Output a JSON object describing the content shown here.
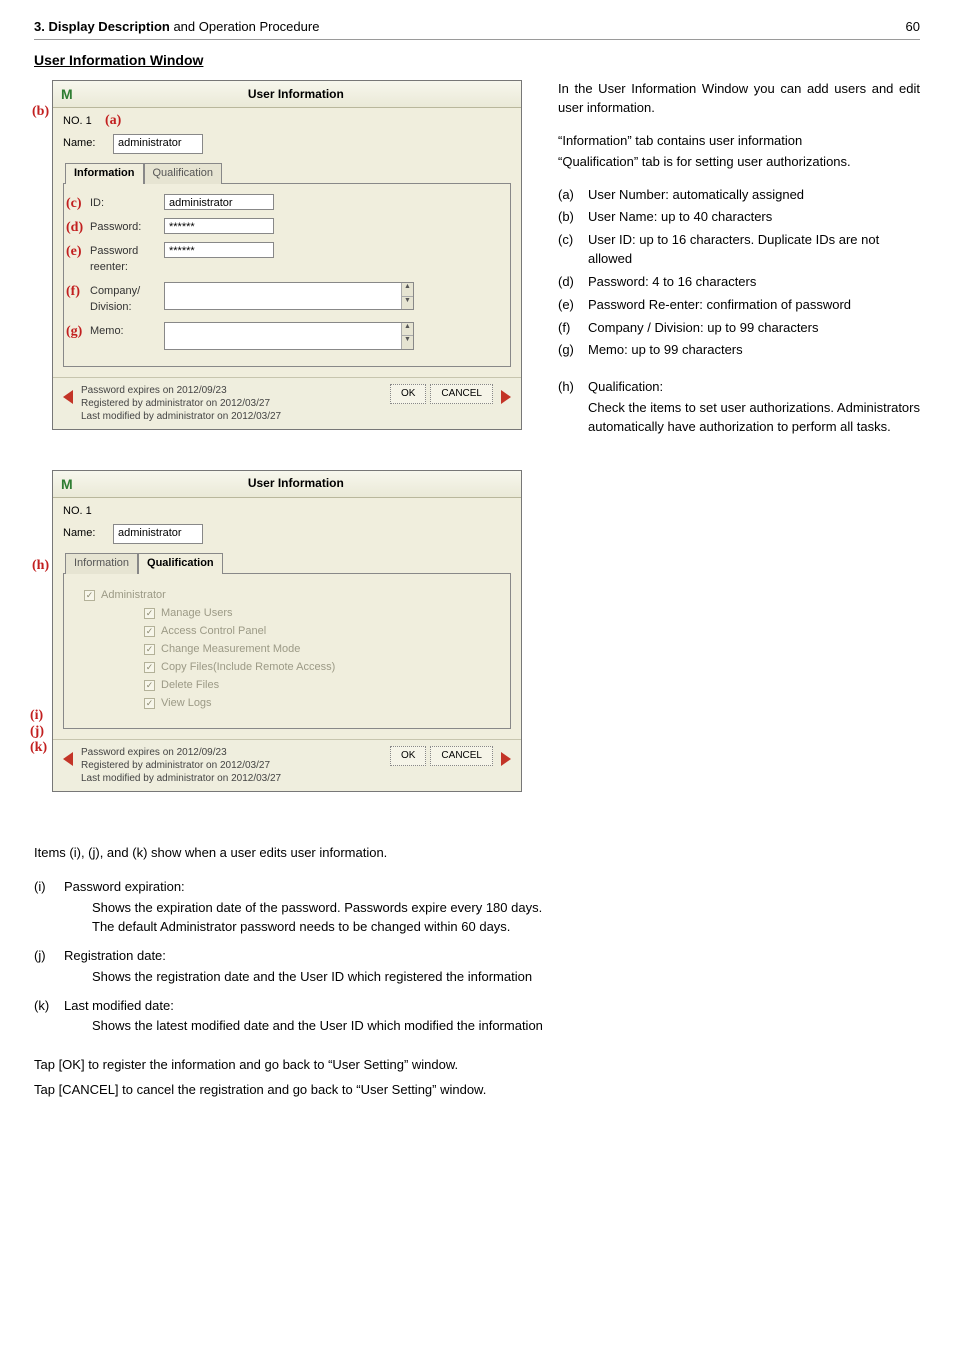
{
  "header": {
    "chapter_bold": "3. Display Description",
    "chapter_rest": " and Operation Procedure",
    "page": "60"
  },
  "section_title": "User Information Window",
  "dialog1": {
    "title": "User Information",
    "no_label": "NO. 1",
    "name_label": "Name:",
    "name_value": "administrator",
    "tabs": {
      "info": "Information",
      "qual": "Qualification"
    },
    "fields": {
      "id_label": "ID:",
      "id_value": "administrator",
      "pw_label": "Password:",
      "pw_value": "******",
      "pwr_label": "Password\nreenter:",
      "pwr_value": "******",
      "comp_label": "Company/\nDivision:",
      "memo_label": "Memo:"
    },
    "footer": {
      "l1": "Password expires on 2012/09/23",
      "l2": "Registered by administrator on 2012/03/27",
      "l3": "Last modified by administrator on 2012/03/27",
      "ok": "OK",
      "cancel": "CANCEL"
    },
    "annots": {
      "a": "(a)",
      "b": "(b)",
      "c": "(c)",
      "d": "(d)",
      "e": "(e)",
      "f": "(f)",
      "g": "(g)"
    }
  },
  "dialog2": {
    "title": "User Information",
    "no_label": "NO. 1",
    "name_label": "Name:",
    "name_value": "administrator",
    "tabs": {
      "info": "Information",
      "qual": "Qualification"
    },
    "qual": {
      "admin": "Administrator",
      "items": [
        "Manage Users",
        "Access Control Panel",
        "Change Measurement Mode",
        "Copy Files(Include Remote Access)",
        "Delete Files",
        "View Logs"
      ]
    },
    "footer": {
      "l1": "Password expires on 2012/09/23",
      "l2": "Registered by administrator on 2012/03/27",
      "l3": "Last modified by administrator on 2012/03/27",
      "ok": "OK",
      "cancel": "CANCEL"
    },
    "annots": {
      "h": "(h)",
      "i": "(i)",
      "j": "(j)",
      "k": "(k)"
    }
  },
  "right": {
    "p1": "In the User Information Window you can add users and edit user information.",
    "p2a": "“Information” tab contains user information",
    "p2b": "“Qualification” tab is for setting user authorizations.",
    "list": [
      {
        "b": "(a)",
        "t": "User Number: automatically assigned"
      },
      {
        "b": "(b)",
        "t": "User Name: up to 40 characters"
      },
      {
        "b": "(c)",
        "t": "User ID: up to 16 characters. Duplicate IDs are not allowed"
      },
      {
        "b": "(d)",
        "t": "Password: 4 to 16 characters"
      },
      {
        "b": "(e)",
        "t": "Password Re-enter: confirmation of password"
      },
      {
        "b": "(f)",
        "t": "Company / Division: up to 99 characters"
      },
      {
        "b": "(g)",
        "t": "Memo: up to 99 characters"
      }
    ],
    "h_label": "(h)",
    "h_title": "Qualification:",
    "h_body": "Check the items to set user authorizations. Administrators automatically have authorization to perform all tasks."
  },
  "lower": {
    "intro": "Items (i), (j), and (k) show when a user edits user information.",
    "items": [
      {
        "b": "(i)",
        "t": "Password expiration:",
        "d": [
          "Shows the expiration date of the password. Passwords expire every 180 days.",
          "The default Administrator password needs to be changed within 60 days."
        ]
      },
      {
        "b": "(j)",
        "t": "Registration date:",
        "d": [
          "Shows the registration date and the User ID which registered the information"
        ]
      },
      {
        "b": "(k)",
        "t": "Last modified date:",
        "d": [
          "Shows the latest modified date and the User ID which modified the information"
        ]
      }
    ],
    "tail1": "Tap [OK] to register the information and go back to “User Setting” window.",
    "tail2": "Tap [CANCEL] to cancel the registration and go back to “User Setting” window."
  }
}
